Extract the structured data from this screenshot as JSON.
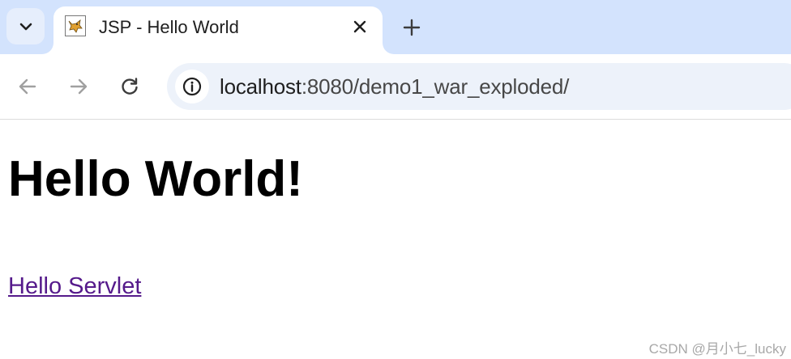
{
  "browser": {
    "tab_search_icon": "chevron-down-icon",
    "tab": {
      "title": "JSP - Hello World",
      "favicon": "tomcat-favicon",
      "close_icon": "close-icon"
    },
    "new_tab_icon": "plus-icon",
    "nav": {
      "back_icon": "arrow-left-icon",
      "forward_icon": "arrow-right-icon",
      "reload_icon": "reload-icon"
    },
    "address_bar": {
      "site_info_icon": "info-icon",
      "host": "localhost",
      "path": ":8080/demo1_war_exploded/"
    },
    "colors": {
      "tabstrip": "#d3e3fd",
      "omnibox": "#edf2fa",
      "visited_link": "#551a8b"
    }
  },
  "page": {
    "heading": "Hello World!",
    "link_text": "Hello Servlet"
  },
  "watermark": "CSDN @月小七_lucky"
}
